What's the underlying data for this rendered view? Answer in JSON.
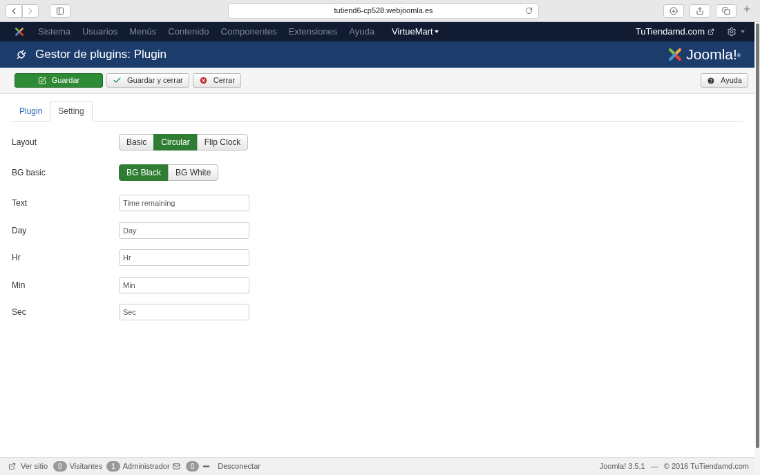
{
  "browser": {
    "url": "tutiend6-cp528.webjoomla.es"
  },
  "nav": {
    "items": [
      {
        "label": "Sistema",
        "kind": "plain"
      },
      {
        "label": "Usuarios",
        "kind": "plain"
      },
      {
        "label": "Menús",
        "kind": "plain"
      },
      {
        "label": "Contenido",
        "kind": "plain"
      },
      {
        "label": "Componentes",
        "kind": "plain"
      },
      {
        "label": "Extensiones",
        "kind": "plain"
      },
      {
        "label": "Ayuda",
        "kind": "plain"
      },
      {
        "label": "VirtueMart",
        "kind": "dropdown"
      }
    ],
    "site_link": "TuTiendamd.com"
  },
  "header": {
    "title": "Gestor de plugins: Plugin",
    "logo_text": "Joomla!",
    "logo_mark": "®"
  },
  "toolbar": {
    "buttons": [
      {
        "label": "Guardar",
        "kind": "primary"
      },
      {
        "label": "Guardar y cerrar",
        "kind": "check"
      },
      {
        "label": "Cerrar",
        "kind": "close"
      }
    ],
    "help": "Ayuda"
  },
  "tabs": [
    {
      "label": "Plugin",
      "selected": false
    },
    {
      "label": "Setting",
      "selected": true
    }
  ],
  "fields": [
    {
      "label": "Layout",
      "kind": "toggle",
      "options": [
        {
          "label": "Basic",
          "selected": false
        },
        {
          "label": "Circular",
          "selected": true
        },
        {
          "label": "Flip Clock",
          "selected": false
        }
      ]
    },
    {
      "label": "BG basic",
      "kind": "toggle",
      "options": [
        {
          "label": "BG Black",
          "selected": true
        },
        {
          "label": "BG White",
          "selected": false
        }
      ]
    },
    {
      "label": "Text",
      "kind": "text",
      "value": "Time remaining"
    },
    {
      "label": "Day",
      "kind": "text",
      "value": "Day"
    },
    {
      "label": "Hr",
      "kind": "text",
      "value": "Hr"
    },
    {
      "label": "Min",
      "kind": "text",
      "value": "Min"
    },
    {
      "label": "Sec",
      "kind": "text",
      "value": "Sec"
    }
  ],
  "status_bar": {
    "view_site": "Ver sitio",
    "visitors_count": "0",
    "visitors": "Visitantes",
    "admin_count": "1",
    "admin": "Administrador",
    "messages_count": "0",
    "logout": "Desconectar",
    "version": "Joomla! 3.5.1",
    "separator": "—",
    "copyright": "© 2016 TuTiendamd.com"
  }
}
